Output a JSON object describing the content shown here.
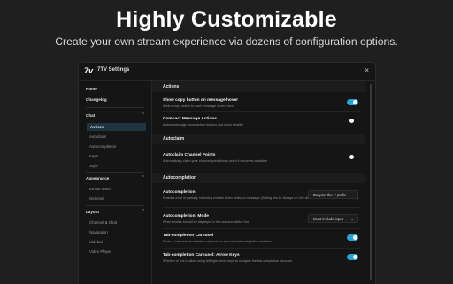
{
  "hero": {
    "title": "Highly Customizable",
    "subtitle": "Create your own stream experience via dozens of configuration options."
  },
  "window": {
    "logo": "7v",
    "title": "7TV Settings",
    "close": "×"
  },
  "sidebar": {
    "items": [
      {
        "label": "Home"
      },
      {
        "label": "Changelog"
      },
      {
        "label": "Chat",
        "chevron": "^"
      },
      {
        "label": "Actions"
      },
      {
        "label": "Autoclaim"
      },
      {
        "label": "Autocompletion"
      },
      {
        "label": "Input"
      },
      {
        "label": "Style"
      },
      {
        "label": "Appearance",
        "chevron": "^"
      },
      {
        "label": "Emote Menu"
      },
      {
        "label": "General"
      },
      {
        "label": "Layout",
        "chevron": "^"
      },
      {
        "label": "Channel & Chat"
      },
      {
        "label": "Navigation"
      },
      {
        "label": "Sidebar"
      },
      {
        "label": "Video Player"
      }
    ]
  },
  "main": {
    "sections": [
      {
        "title": "Actions"
      },
      {
        "title": "Autoclaim"
      },
      {
        "title": "Autocompletion"
      }
    ],
    "settings": [
      {
        "name": "Show copy button on message hover",
        "desc": "Adds a copy action to each message hover menu",
        "control": "toggle",
        "on": true
      },
      {
        "name": "Compact Message Actions",
        "desc": "Makes message hover action buttons and icons smaller",
        "control": "toggle",
        "on": false
      },
      {
        "name": "Autoclaim Channel Points",
        "desc": "Automatically claim your channel point bonus when it becomes available",
        "control": "toggle",
        "on": false
      },
      {
        "name": "Autocompletion",
        "desc": "Enables a list of partially matching emotes when writing a message (Setting this to 'Always on' will disable the Tab-completion Carousel)",
        "control": "dropdown",
        "value": "Require the ':' prefix"
      },
      {
        "name": "Autocompletion: Mode",
        "desc": "What emotes should be displayed in the autocompletion list",
        "control": "dropdown",
        "value": "Must include input"
      },
      {
        "name": "Tab-completion Carousel",
        "desc": "Show a carousel visualization of previous and next tab-completion matches",
        "control": "toggle",
        "on": true
      },
      {
        "name": "Tab-completion Carousel: Arrow Keys",
        "desc": "Whether or not to allow using left/right arrow keys to navigate the tab-completion carousel",
        "control": "toggle",
        "on": true
      }
    ]
  },
  "colors": {
    "accent": "#29a3d6",
    "background": "#1f1f1f",
    "panel": "#151515"
  }
}
